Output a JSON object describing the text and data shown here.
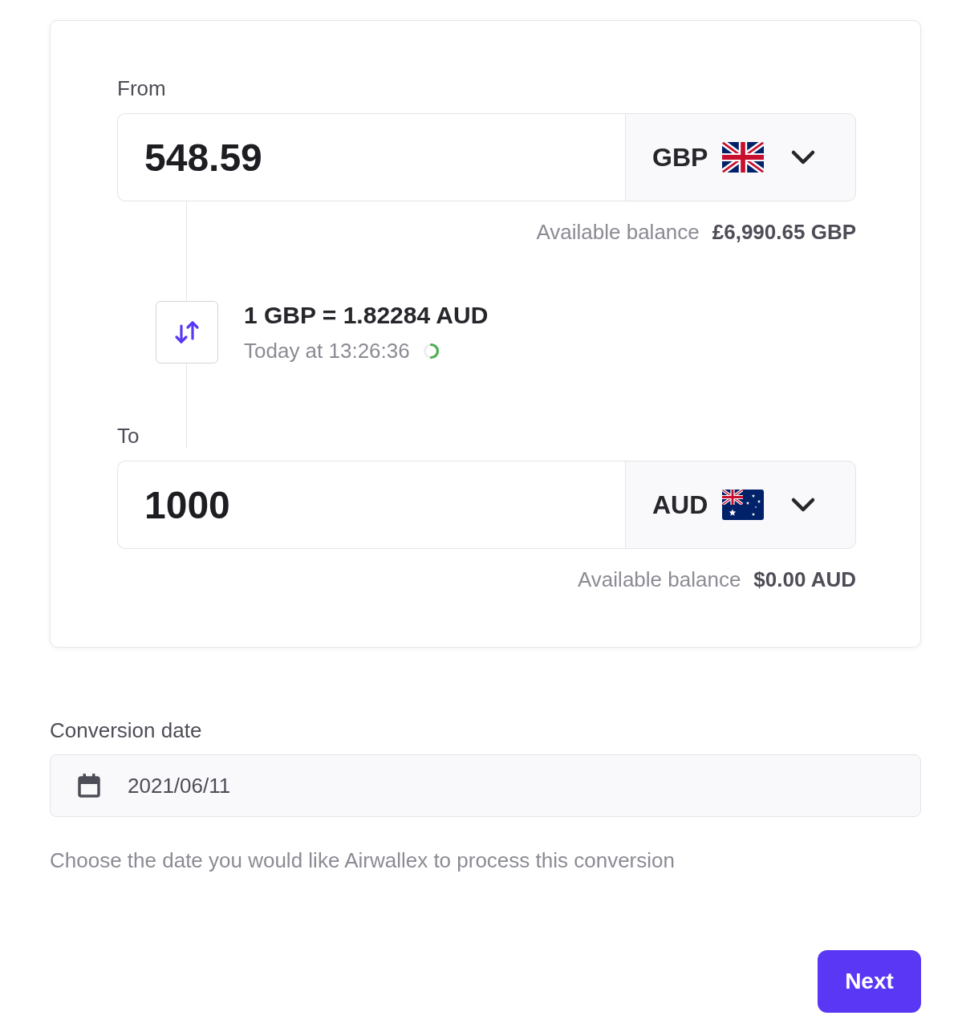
{
  "card": {
    "from": {
      "label": "From",
      "amount": "548.59",
      "currency": "GBP",
      "balance_label": "Available balance",
      "balance": "£6,990.65 GBP"
    },
    "rate": {
      "text": "1 GBP = 1.82284 AUD",
      "time": "Today at 13:26:36"
    },
    "to": {
      "label": "To",
      "amount": "1000",
      "currency": "AUD",
      "balance_label": "Available balance",
      "balance": "$0.00 AUD"
    }
  },
  "conversion_date": {
    "label": "Conversion date",
    "value": "2021/06/11",
    "help": "Choose the date you would like Airwallex to process this conversion"
  },
  "buttons": [
    {
      "label": "Next"
    }
  ]
}
